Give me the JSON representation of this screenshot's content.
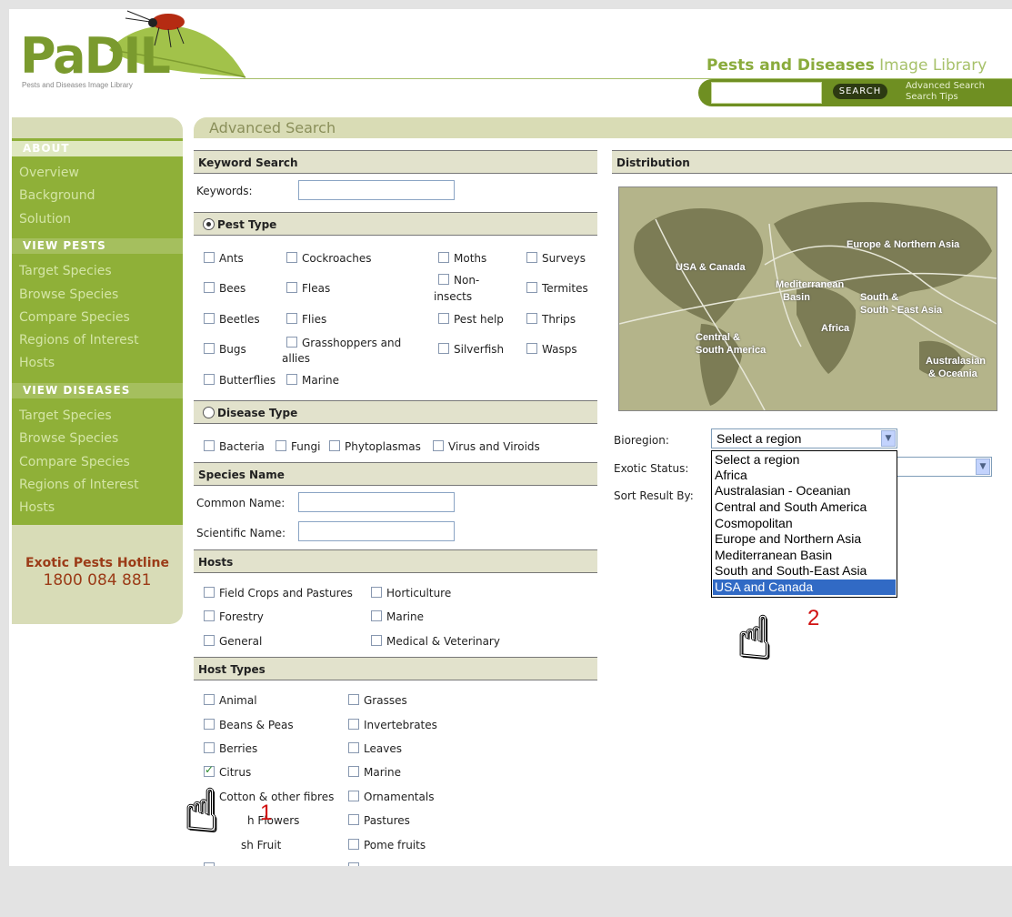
{
  "header": {
    "logo": "PaDIL",
    "logo_sub": "Pests and Diseases Image Library",
    "tagline_bold": "Pests and Diseases",
    "tagline_light": "Image Library",
    "search_button": "SEARCH",
    "advanced_search": "Advanced Search",
    "search_tips": "Search Tips"
  },
  "sidebar": {
    "about": "ABOUT",
    "about_items": [
      "Overview",
      "Background",
      "Solution"
    ],
    "view_pests": "VIEW PESTS",
    "pests_items": [
      "Target Species",
      "Browse Species",
      "Compare Species",
      "Regions of Interest",
      "Hosts"
    ],
    "view_diseases": "VIEW DISEASES",
    "diseases_items": [
      "Target Species",
      "Browse Species",
      "Compare Species",
      "Regions of Interest",
      "Hosts"
    ],
    "hotline_title": "Exotic Pests Hotline",
    "hotline_number": "1800 084 881"
  },
  "page_title": "Advanced Search",
  "keyword": {
    "section": "Keyword Search",
    "label": "Keywords:"
  },
  "pest_type": {
    "section": "Pest Type",
    "items": [
      "Ants",
      "Cockroaches",
      "Moths",
      "Surveys",
      "Bees",
      "Fleas",
      "Non-",
      "insects",
      "Termites",
      "Beetles",
      "Flies",
      "Pest help",
      "Thrips",
      "Bugs",
      "Grasshoppers and",
      "allies",
      "Silverfish",
      "Wasps",
      "Butterflies",
      "Marine"
    ]
  },
  "disease_type": {
    "section": "Disease Type",
    "items": [
      "Bacteria",
      "Fungi",
      "Phytoplasmas",
      "Virus and Viroids"
    ]
  },
  "species": {
    "section": "Species Name",
    "common": "Common Name:",
    "scientific": "Scientific Name:"
  },
  "hosts": {
    "section": "Hosts",
    "items": [
      "Field Crops and Pastures",
      "Horticulture",
      "Forestry",
      "Marine",
      "General",
      "Medical & Veterinary"
    ]
  },
  "host_types": {
    "section": "Host Types",
    "items": [
      "Animal",
      "Grasses",
      "Beans & Peas",
      "Invertebrates",
      "Berries",
      "Leaves",
      "Citrus",
      "Marine",
      "Cotton & other fibres",
      "Ornamentals",
      "h Flowers",
      "Pastures",
      "sh Fruit",
      "Pome fruits"
    ],
    "citrus_checked": true
  },
  "distribution": {
    "section": "Distribution",
    "map_labels": [
      "USA & Canada",
      "Europe & Northern Asia",
      "Mediterranean",
      "Basin",
      "South &",
      "South - East Asia",
      "Africa",
      "Central &",
      "South America",
      "Australasian",
      "& Oceania"
    ],
    "bioregion_label": "Bioregion:",
    "exotic_label": "Exotic Status:",
    "sort_label": "Sort Result By:",
    "selected": "Select a region",
    "options": [
      "Select a region",
      "Africa",
      "Australasian - Oceanian",
      "Central and South America",
      "Cosmopolitan",
      "Europe and Northern Asia",
      "Mediterranean Basin",
      "South and South-East Asia",
      "USA and Canada"
    ],
    "highlighted_index": 8
  },
  "annotations": {
    "marker1": "1",
    "marker2": "2"
  },
  "colors": {
    "brand_green": "#8fb038",
    "hotline": "#9b3b17",
    "highlight": "#316ac5"
  }
}
